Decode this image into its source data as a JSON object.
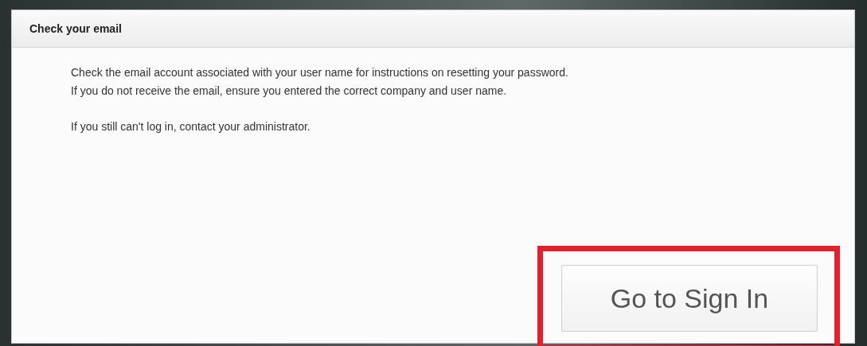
{
  "dialog": {
    "title": "Check your email",
    "paragraphs": [
      "Check the email account associated with your user name for instructions on resetting your password.\nIf you do not receive the email, ensure you entered the correct company and user name.",
      "If you still can't log in, contact your administrator."
    ],
    "button": {
      "label": "Go to Sign In",
      "highlighted": true
    }
  }
}
